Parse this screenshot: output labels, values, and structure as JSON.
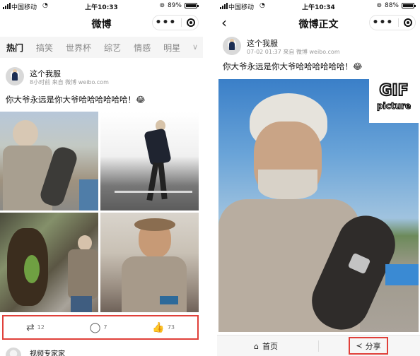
{
  "left": {
    "status": {
      "carrier": "中国移动",
      "time": "上午10:33",
      "battery": "89%",
      "battery_level": 0.89
    },
    "nav": {
      "title": "微博"
    },
    "tabs": [
      "热门",
      "搞笑",
      "世界杯",
      "综艺",
      "情感",
      "明星"
    ],
    "active_tab": "热门",
    "post": {
      "author": "这个我服",
      "time": "8小时前",
      "source": "来自 微博 weibo.com",
      "text": "你大爷永远是你大爷哈哈哈哈哈哈！😂"
    },
    "actions": {
      "repost": "12",
      "comment": "7",
      "like": "73"
    },
    "next_post": {
      "author": "视频专家家"
    }
  },
  "right": {
    "status": {
      "carrier": "中国移动",
      "time": "上午10:34",
      "battery": "88%",
      "battery_level": 0.88
    },
    "nav": {
      "title": "微博正文"
    },
    "post": {
      "author": "这个我服",
      "time": "07-02 01:37",
      "source": "来自 微博 weibo.com",
      "text": "你大爷永远是你大爷哈哈哈哈哈哈！😂"
    },
    "badge": {
      "line1": "GIF",
      "line2": "picture"
    },
    "bottom": {
      "home": "首页",
      "share": "分享"
    }
  },
  "colors": {
    "highlight": "#e0403a",
    "tab_bg": "#f5f5f5",
    "muted": "#999999"
  },
  "icons": [
    "signal-icon",
    "wifi-icon",
    "alarm-icon",
    "battery-icon",
    "more-icon",
    "target-icon",
    "chevron-down-icon",
    "back-icon",
    "repost-icon",
    "comment-icon",
    "like-icon",
    "home-icon",
    "share-icon"
  ]
}
